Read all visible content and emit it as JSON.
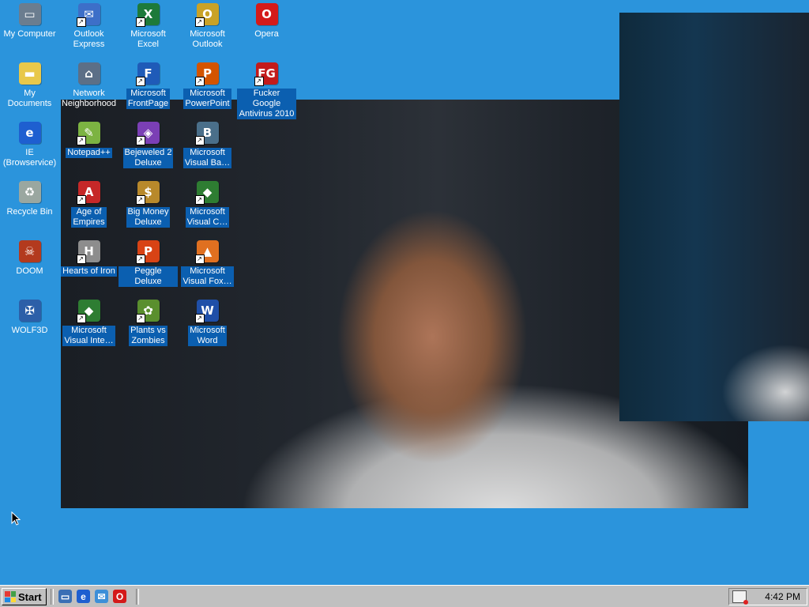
{
  "desktop_icons": [
    {
      "label": "My Computer",
      "icon": "computer-icon",
      "shortcut": false,
      "selected": false,
      "color": "#6b7d8f",
      "glyph": "▭"
    },
    {
      "label": "My Documents",
      "icon": "folder-icon",
      "shortcut": false,
      "selected": false,
      "color": "#e8c84a",
      "glyph": "▬"
    },
    {
      "label": "IE\n(Browservice)",
      "icon": "ie-icon",
      "shortcut": false,
      "selected": false,
      "color": "#1e5fd0",
      "glyph": "e"
    },
    {
      "label": "Recycle Bin",
      "icon": "recycle-bin-icon",
      "shortcut": false,
      "selected": false,
      "color": "#9aa7a0",
      "glyph": "♻"
    },
    {
      "label": "DOOM",
      "icon": "doom-icon",
      "shortcut": false,
      "selected": false,
      "color": "#b33a1e",
      "glyph": "☠"
    },
    {
      "label": "WOLF3D",
      "icon": "wolf3d-icon",
      "shortcut": false,
      "selected": false,
      "color": "#2c5fa8",
      "glyph": "✠"
    },
    {
      "label": "Outlook\nExpress",
      "icon": "outlook-express-icon",
      "shortcut": true,
      "selected": false,
      "color": "#3d6fc8",
      "glyph": "✉"
    },
    {
      "label": "Network\nNeighborhood",
      "icon": "network-icon",
      "shortcut": false,
      "selected": false,
      "color": "#5c6f87",
      "glyph": "⌂"
    },
    {
      "label": "Notepad++",
      "icon": "notepad-plus-plus-icon",
      "shortcut": true,
      "selected": true,
      "color": "#7cb342",
      "glyph": "✎"
    },
    {
      "label": "Age of\nEmpires",
      "icon": "age-of-empires-icon",
      "shortcut": true,
      "selected": true,
      "color": "#c62828",
      "glyph": "A"
    },
    {
      "label": "Hearts of Iron",
      "icon": "hearts-of-iron-icon",
      "shortcut": true,
      "selected": true,
      "color": "#8d8d8d",
      "glyph": "H"
    },
    {
      "label": "Microsoft\nVisual Inte…",
      "icon": "visual-interdev-icon",
      "shortcut": true,
      "selected": true,
      "color": "#2e7d32",
      "glyph": "◆"
    },
    {
      "label": "Microsoft\nExcel",
      "icon": "excel-icon",
      "shortcut": true,
      "selected": false,
      "color": "#1d7a3a",
      "glyph": "X"
    },
    {
      "label": "Microsoft\nFrontPage",
      "icon": "frontpage-icon",
      "shortcut": true,
      "selected": true,
      "color": "#1f5bb8",
      "glyph": "F"
    },
    {
      "label": "Bejeweled 2\nDeluxe",
      "icon": "bejeweled-icon",
      "shortcut": true,
      "selected": true,
      "color": "#7b3fb5",
      "glyph": "◈"
    },
    {
      "label": "Big Money\nDeluxe",
      "icon": "big-money-icon",
      "shortcut": true,
      "selected": true,
      "color": "#b8892b",
      "glyph": "$"
    },
    {
      "label": "Peggle Deluxe",
      "icon": "peggle-icon",
      "shortcut": true,
      "selected": true,
      "color": "#d84315",
      "glyph": "P"
    },
    {
      "label": "Plants vs\nZombies",
      "icon": "plants-vs-zombies-icon",
      "shortcut": true,
      "selected": true,
      "color": "#5a8f2e",
      "glyph": "✿"
    },
    {
      "label": "Microsoft\nOutlook",
      "icon": "outlook-icon",
      "shortcut": true,
      "selected": false,
      "color": "#c9a227",
      "glyph": "O"
    },
    {
      "label": "Microsoft\nPowerPoint",
      "icon": "powerpoint-icon",
      "shortcut": true,
      "selected": true,
      "color": "#d35400",
      "glyph": "P"
    },
    {
      "label": "Microsoft\nVisual Ba…",
      "icon": "visual-basic-icon",
      "shortcut": true,
      "selected": true,
      "color": "#4a6f8a",
      "glyph": "B"
    },
    {
      "label": "Microsoft\nVisual C…",
      "icon": "visual-cpp-icon",
      "shortcut": true,
      "selected": true,
      "color": "#2e7d32",
      "glyph": "◆"
    },
    {
      "label": "Microsoft\nVisual Fox…",
      "icon": "visual-foxpro-icon",
      "shortcut": true,
      "selected": true,
      "color": "#e07020",
      "glyph": "▲"
    },
    {
      "label": "Microsoft\nWord",
      "icon": "word-icon",
      "shortcut": true,
      "selected": true,
      "color": "#1f4fa8",
      "glyph": "W"
    },
    {
      "label": "Opera",
      "icon": "opera-icon",
      "shortcut": false,
      "selected": false,
      "color": "#d41a1a",
      "glyph": "O"
    },
    {
      "label": "Fucker Google\nAntivirus 2010",
      "icon": "antivirus-icon",
      "shortcut": true,
      "selected": true,
      "color": "#c21b1b",
      "glyph": "FG"
    }
  ],
  "taskbar": {
    "start_label": "Start",
    "quick_launch": [
      {
        "icon": "show-desktop-icon",
        "color": "#3a6fb5",
        "glyph": "▭"
      },
      {
        "icon": "ie-icon",
        "color": "#1e5fd0",
        "glyph": "e"
      },
      {
        "icon": "outlook-express-icon",
        "color": "#3d8fd8",
        "glyph": "✉"
      },
      {
        "icon": "opera-icon",
        "color": "#d41a1a",
        "glyph": "O"
      }
    ],
    "tray_icon": "scheduler-icon",
    "clock": "4:42 PM"
  }
}
